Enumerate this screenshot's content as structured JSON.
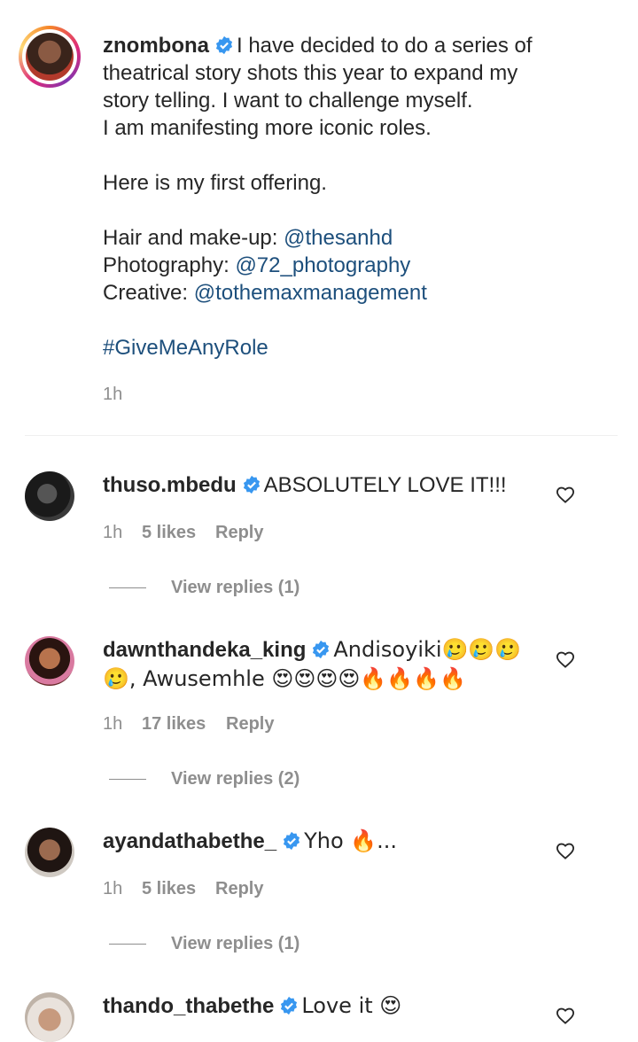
{
  "post": {
    "username": "znombona",
    "lines": [
      "I have decided to do a series of",
      "theatrical story shots this year to expand my",
      "story telling. I want to challenge myself.",
      "I am manifesting more iconic roles.",
      "Here is my first offering."
    ],
    "hair_label": "Hair and make-up: ",
    "hair_handle": "@thesanhd",
    "photo_label": "Photography: ",
    "photo_handle": "@72_photography",
    "creative_label": "Creative: ",
    "creative_handle": "@tothemaxmanagement",
    "hashtag": "#GiveMeAnyRole",
    "time": "1h"
  },
  "comments": [
    {
      "username": "thuso.mbedu",
      "text": "ABSOLUTELY LOVE IT!!!",
      "time": "1h",
      "likes": "5 likes",
      "reply": "Reply",
      "view_replies": "View replies (1)"
    },
    {
      "username": "dawnthandeka_king",
      "text_line1": "Andisoyiki🥲🥲🥲",
      "text_line2": "🥲, Awusemhle 😍😍😍😍🔥🔥🔥🔥",
      "time": "1h",
      "likes": "17 likes",
      "reply": "Reply",
      "view_replies": "View replies (2)"
    },
    {
      "username": "ayandathabethe_",
      "text": "Yho 🔥...",
      "time": "1h",
      "likes": "5 likes",
      "reply": "Reply",
      "view_replies": "View replies (1)"
    },
    {
      "username": "thando_thabethe",
      "text": "Love it 😍"
    }
  ],
  "colors": {
    "link": "#1d4f7c",
    "verified": "#3897f0",
    "meta": "#8e8e8e"
  },
  "icons": [
    "verified-badge-icon",
    "heart-icon"
  ]
}
